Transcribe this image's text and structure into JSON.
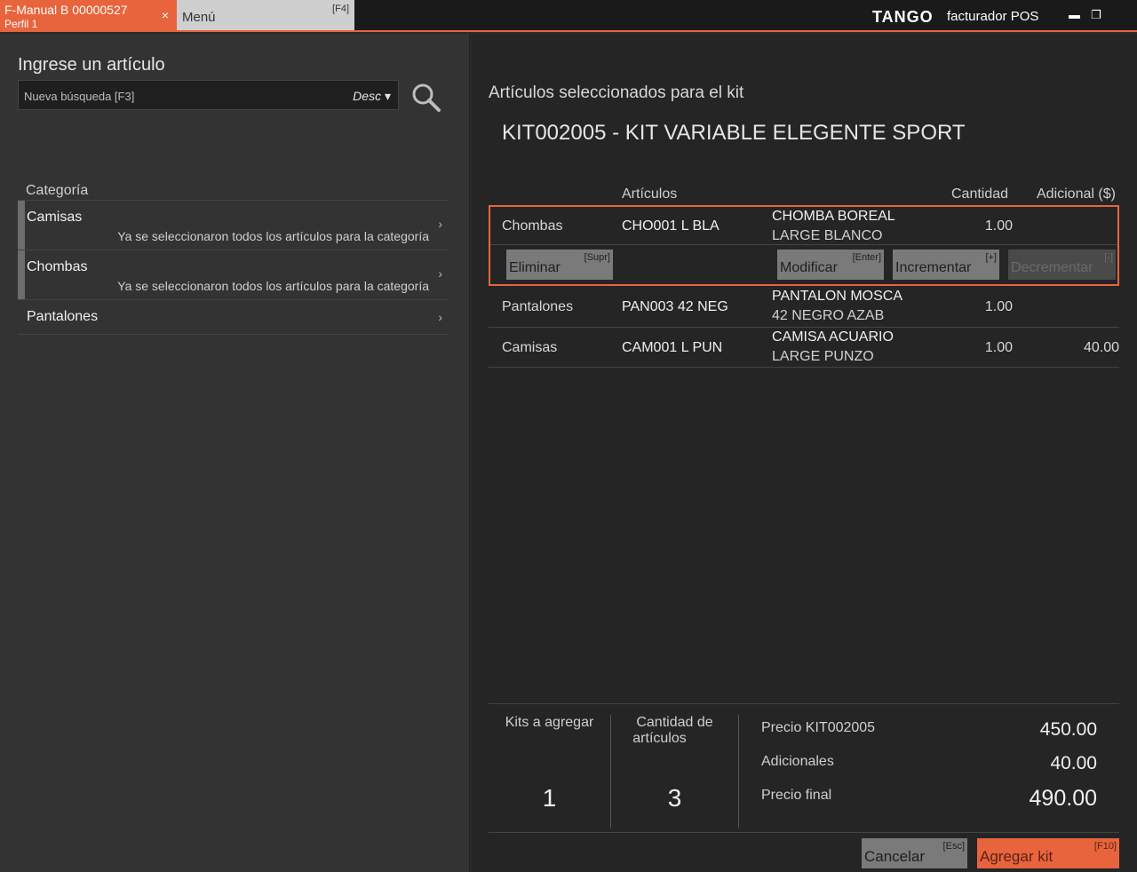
{
  "tabs": {
    "active_title": "F-Manual B 00000527",
    "active_subtitle": "Perfil 1",
    "close": "×",
    "menu_label": "Menú",
    "menu_key": "[F4]"
  },
  "brand": {
    "logo": "TANGO",
    "product": "facturador POS",
    "minimize": "▬",
    "restore": "❐"
  },
  "search": {
    "title": "Ingrese un artículo",
    "placeholder": "Nueva búsqueda [F3]",
    "mode": "Desc ▾"
  },
  "categories": {
    "header": "Categoría",
    "items": [
      {
        "name": "Camisas",
        "note": "Ya se seleccionaron todos los artículos para la categoría"
      },
      {
        "name": "Chombas",
        "note": "Ya se seleccionaron todos los artículos para la categoría"
      },
      {
        "name": "Pantalones",
        "note": ""
      }
    ],
    "chevron": "›"
  },
  "kit": {
    "title": "Artículos seleccionados para el kit",
    "code_name": "KIT002005  -  KIT VARIABLE ELEGENTE SPORT",
    "columns": {
      "articles": "Artículos",
      "qty": "Cantidad",
      "extra": "Adicional ($)"
    },
    "rows": [
      {
        "category": "Chombas",
        "code": "CHO001   L  BLA",
        "desc1": "CHOMBA BOREAL",
        "desc2": "LARGE BLANCO",
        "qty": "1.00",
        "extra": ""
      },
      {
        "category": "Pantalones",
        "code": "PAN003   42 NEG",
        "desc1": "PANTALON MOSCA",
        "desc2": "42 NEGRO AZAB",
        "qty": "1.00",
        "extra": ""
      },
      {
        "category": "Camisas",
        "code": "CAM001   L  PUN",
        "desc1": "CAMISA ACUARIO",
        "desc2": "LARGE PUNZO",
        "qty": "1.00",
        "extra": "40.00"
      }
    ],
    "actions": {
      "delete": {
        "label": "Eliminar",
        "key": "[Supr]"
      },
      "modify": {
        "label": "Modificar",
        "key": "[Enter]"
      },
      "increment": {
        "label": "Incrementar",
        "key": "[+]"
      },
      "decrement": {
        "label": "Decrementar",
        "key": "[-]"
      }
    }
  },
  "summary": {
    "kits_label": "Kits a agregar",
    "kits_value": "1",
    "count_label1": "Cantidad de",
    "count_label2": "artículos",
    "count_value": "3",
    "price_label": "Precio  KIT002005",
    "price_value": "450.00",
    "extras_label": "Adicionales",
    "extras_value": "40.00",
    "final_label": "Precio final",
    "final_value": "490.00"
  },
  "buttons": {
    "cancel": {
      "label": "Cancelar",
      "key": "[Esc]"
    },
    "add": {
      "label": "Agregar kit",
      "key": "[F10]"
    }
  },
  "colors": {
    "accent": "#e8643c"
  }
}
